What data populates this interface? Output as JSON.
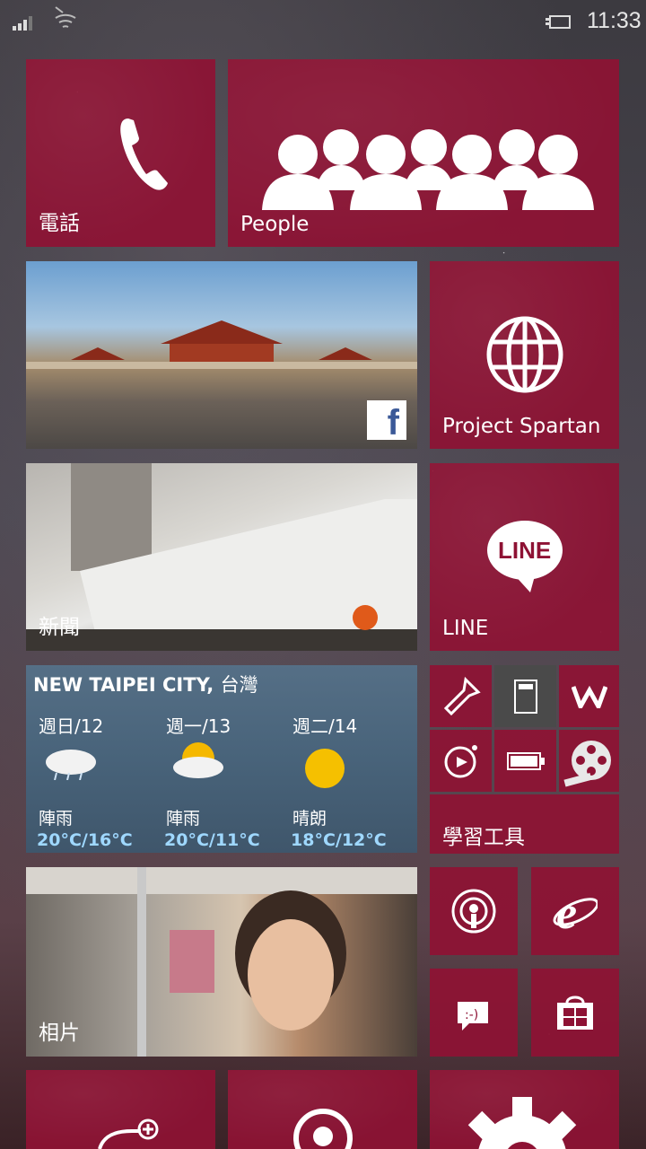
{
  "statusbar": {
    "time": "11:33"
  },
  "tiles": {
    "phone": {
      "label": "電話",
      "icon": "phone-icon"
    },
    "people": {
      "label": "People",
      "icon": "people-group-icon"
    },
    "facebook_photo": {
      "icon": "facebook-icon"
    },
    "spartan": {
      "label": "Project Spartan",
      "icon": "globe-icon"
    },
    "news": {
      "label": "新聞"
    },
    "line": {
      "label": "LINE",
      "logo_text": "LINE"
    },
    "tools": {
      "label": "學習工具"
    },
    "photos": {
      "label": "相片"
    }
  },
  "weather": {
    "city": "NEW TAIPEI CITY,",
    "country": "台灣",
    "days": [
      {
        "day": "週日/12",
        "condition": "陣雨",
        "temp": "20°C/16°C",
        "icon": "cloud-rain-icon"
      },
      {
        "day": "週一/13",
        "condition": "陣雨",
        "temp": "20°C/11°C",
        "icon": "sun-cloud-icon"
      },
      {
        "day": "週二/14",
        "condition": "晴朗",
        "temp": "18°C/12°C",
        "icon": "sun-icon"
      }
    ]
  },
  "small_tiles": {
    "flashlight": "flashlight-icon",
    "calculator": "calculator-icon",
    "w_app": "w-logo-icon",
    "recorder": "recorder-icon",
    "battery": "battery-icon",
    "video": "film-reel-icon",
    "podcast": "podcast-icon",
    "ie": "internet-explorer-icon",
    "feedback": "feedback-icon",
    "store": "store-icon"
  },
  "colors": {
    "tile_accent": "#8e1234"
  }
}
